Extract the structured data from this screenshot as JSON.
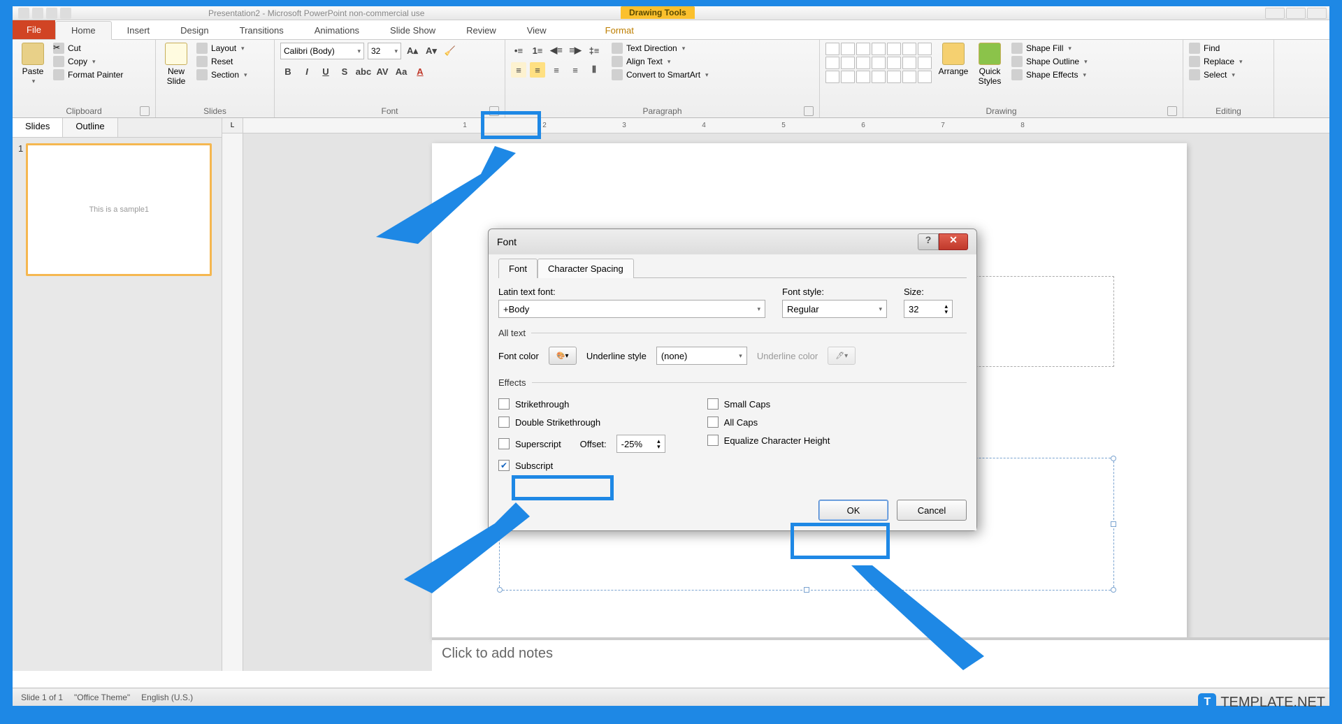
{
  "window": {
    "title": "Presentation2 - Microsoft PowerPoint non-commercial use",
    "context_tab": "Drawing Tools"
  },
  "tabs": {
    "file": "File",
    "home": "Home",
    "insert": "Insert",
    "design": "Design",
    "transitions": "Transitions",
    "animations": "Animations",
    "slideshow": "Slide Show",
    "review": "Review",
    "view": "View",
    "format": "Format"
  },
  "ribbon": {
    "clipboard": {
      "label": "Clipboard",
      "paste": "Paste",
      "cut": "Cut",
      "copy": "Copy",
      "format_painter": "Format Painter"
    },
    "slides": {
      "label": "Slides",
      "new_slide": "New\nSlide",
      "layout": "Layout",
      "reset": "Reset",
      "section": "Section"
    },
    "font": {
      "label": "Font",
      "name": "Calibri (Body)",
      "size": "32"
    },
    "paragraph": {
      "label": "Paragraph",
      "text_direction": "Text Direction",
      "align_text": "Align Text",
      "convert": "Convert to SmartArt"
    },
    "drawing": {
      "label": "Drawing",
      "arrange": "Arrange",
      "quick_styles": "Quick\nStyles",
      "shape_fill": "Shape Fill",
      "shape_outline": "Shape Outline",
      "shape_effects": "Shape Effects"
    },
    "editing": {
      "label": "Editing",
      "find": "Find",
      "replace": "Replace",
      "select": "Select"
    }
  },
  "sidepanel": {
    "tab_slides": "Slides",
    "tab_outline": "Outline",
    "thumb_text": "This is a sample1",
    "slide_num": "1"
  },
  "ruler_marks": [
    "1",
    "2",
    "3",
    "4",
    "5",
    "6",
    "7",
    "8"
  ],
  "dialog": {
    "title": "Font",
    "tab_font": "Font",
    "tab_spacing": "Character Spacing",
    "latin_label": "Latin text font:",
    "latin_value": "+Body",
    "style_label": "Font style:",
    "style_value": "Regular",
    "size_label": "Size:",
    "size_value": "32",
    "alltext": "All text",
    "font_color": "Font color",
    "underline_style": "Underline style",
    "underline_value": "(none)",
    "underline_color": "Underline color",
    "effects": "Effects",
    "strikethrough": "Strikethrough",
    "double_strike": "Double Strikethrough",
    "superscript": "Superscript",
    "subscript": "Subscript",
    "offset_label": "Offset:",
    "offset_value": "-25%",
    "small_caps": "Small Caps",
    "all_caps": "All Caps",
    "equalize": "Equalize Character Height",
    "ok": "OK",
    "cancel": "Cancel",
    "help": "?",
    "close": "✕"
  },
  "notes": {
    "placeholder": "Click to add notes"
  },
  "status": {
    "slide_info": "Slide 1 of 1",
    "theme": "\"Office Theme\"",
    "lang": "English (U.S.)"
  },
  "watermark": {
    "icon": "T",
    "text": "TEMPLATE.NET"
  }
}
